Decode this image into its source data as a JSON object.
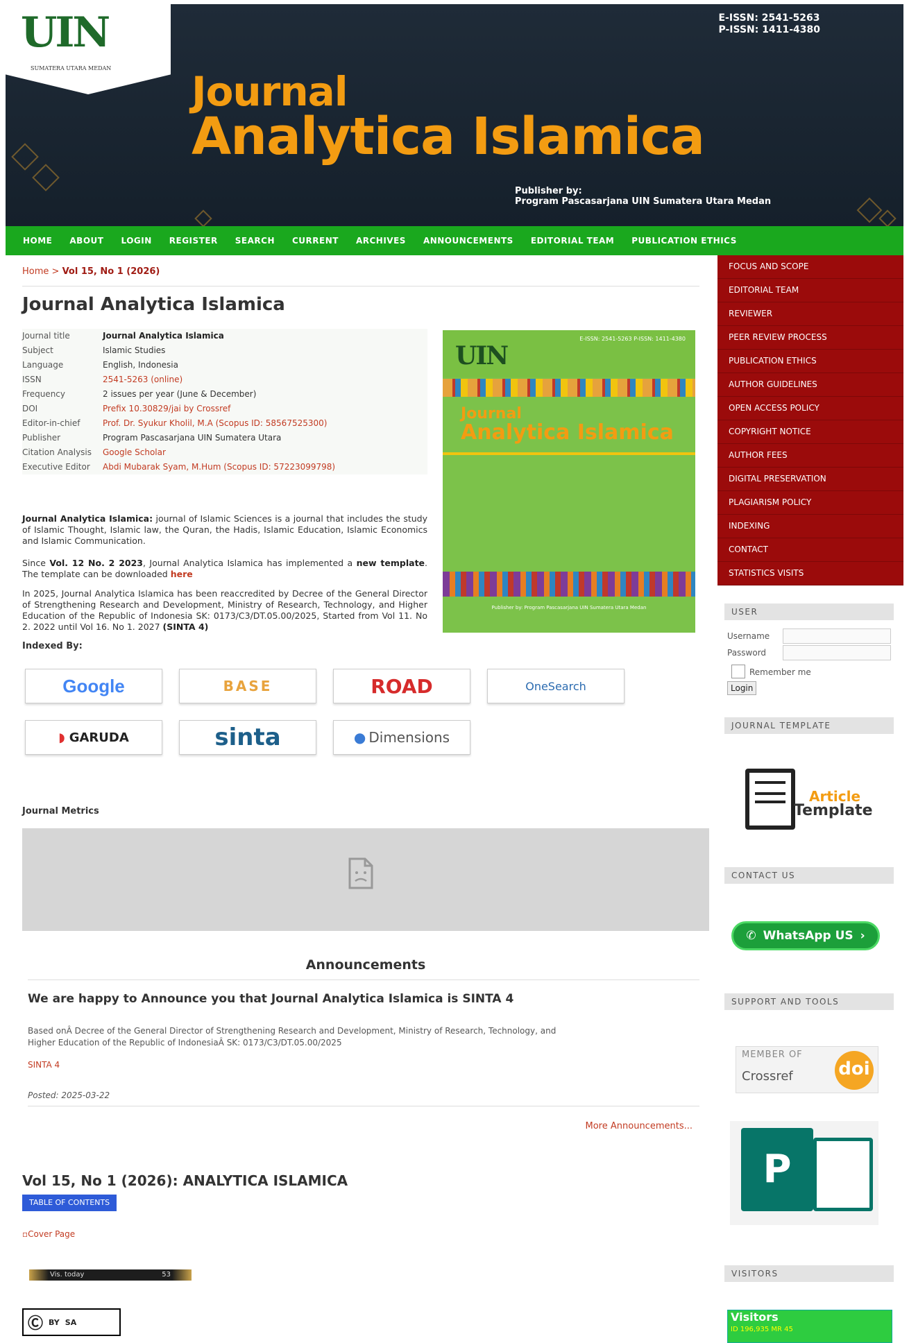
{
  "header": {
    "logo_text": "UIN",
    "logo_sub": "SUMATERA UTARA MEDAN",
    "e_issn": "E-ISSN: 2541-5263",
    "p_issn": "P-ISSN: 1411-4380",
    "journal_word": "Journal",
    "journal_name": "Analytica Islamica",
    "publisher_label": "Publisher by:",
    "publisher_name": "Program Pascasarjana UIN Sumatera Utara Medan"
  },
  "nav": [
    "HOME",
    "ABOUT",
    "LOGIN",
    "REGISTER",
    "SEARCH",
    "CURRENT",
    "ARCHIVES",
    "ANNOUNCEMENTS",
    "EDITORIAL TEAM",
    "PUBLICATION ETHICS"
  ],
  "breadcrumb": {
    "home": "Home",
    "sep": ">",
    "current": "Vol 15, No 1 (2026)"
  },
  "page_title": "Journal Analytica Islamica",
  "info": [
    {
      "label": "Journal title",
      "value": "Journal Analytica Islamica"
    },
    {
      "label": "Subject",
      "value": "Islamic Studies"
    },
    {
      "label": "Language",
      "value": "English, Indonesia"
    },
    {
      "label": "ISSN",
      "value": "2541-5263 (online)"
    },
    {
      "label": "Frequency",
      "value": "2 issues per year (June & December)"
    },
    {
      "label": "DOI",
      "value": "Prefix 10.30829/jai by Crossref"
    },
    {
      "label": "Editor-in-chief",
      "value": "Prof. Dr. Syukur Kholil, M.A (Scopus ID: 58567525300)"
    },
    {
      "label": "Publisher",
      "value": "Program Pascasarjana UIN Sumatera Utara"
    },
    {
      "label": "Citation Analysis",
      "value": "Google Scholar"
    },
    {
      "label": "Executive Editor",
      "value": "Abdi Mubarak Syam, M.Hum (Scopus ID: 57223099798)"
    }
  ],
  "cover": {
    "logo": "UIN",
    "issn": "E-ISSN: 2541-5263 P-ISSN: 1411-4380",
    "title1": "Journal",
    "title2": "Analytica Islamica",
    "pub": "Publisher by: Program Pascasarjana UIN Sumatera Utara Medan"
  },
  "about": {
    "lead": "Journal Analytica Islamica:",
    "text": " journal of Islamic Sciences is a journal that includes the study of Islamic Thought, Islamic law, the Quran, the Hadis, Islamic Education, Islamic Economics and Islamic Communication."
  },
  "template_note": {
    "pre": "Since ",
    "vol": "Vol. 12 No. 2 2023",
    "mid": ", Journal Analytica Islamica has implemented a ",
    "new_template": "new template",
    "post": ". The template can be downloaded ",
    "here": "here"
  },
  "accreditation": {
    "text": "In 2025, Journal Analytica Islamica has been reaccredited by Decree of the General Director of Strengthening Research and Development, Ministry of Research, Technology, and Higher Education of the Republic of Indonesia SK: 0173/C3/DT.05.00/2025, Started from Vol 11. No 2. 2022 until Vol 16. No 1. 2027 ",
    "grade": "(SINTA 4)"
  },
  "indexed_heading": "Indexed By:",
  "badges": [
    "Google",
    "BASE",
    "ROAD",
    "OneSearch",
    "GARUDA",
    "sinta",
    "Dimensions"
  ],
  "metrics_heading": "Journal Metrics",
  "announcements": {
    "heading": "Announcements",
    "title": "We are happy to Announce you that Journal Analytica Islamica is SINTA 4",
    "text": "Based onÂ Decree of the General Director of Strengthening Research and Development, Ministry of Research, Technology, and Higher Education of the Republic of IndonesiaÂ SK: 0173/C3/DT.05.00/2025",
    "link": "SINTA 4",
    "posted": "Posted: 2025-03-22",
    "more": "More Announcements..."
  },
  "issue": {
    "title": "Vol 15, No 1 (2026): ANALYTICA ISLAMICA",
    "toc": "TABLE OF CONTENTS",
    "cover_alt": "Cover Page",
    "counter_label": "Vis. today",
    "counter_value": "53"
  },
  "cc": {
    "by": "BY",
    "sa": "SA"
  },
  "sidebar_menu": [
    "FOCUS AND SCOPE",
    "EDITORIAL TEAM",
    "REVIEWER",
    "PEER REVIEW PROCESS",
    "PUBLICATION ETHICS",
    "AUTHOR GUIDELINES",
    "OPEN ACCESS POLICY",
    "COPYRIGHT NOTICE",
    "AUTHOR FEES",
    "DIGITAL PRESERVATION",
    "PLAGIARISM POLICY",
    "INDEXING",
    "CONTACT",
    "STATISTICS VISITS"
  ],
  "user_block": {
    "title": "USER",
    "username": "Username",
    "password": "Password",
    "remember": "Remember me",
    "login": "Login"
  },
  "template_block": {
    "title": "JOURNAL TEMPLATE",
    "line1": "Article",
    "line2": "Template"
  },
  "contact_block": {
    "title": "CONTACT US",
    "whatsapp": "WhatsApp US"
  },
  "support_block": {
    "title": "SUPPORT AND TOOLS",
    "member": "MEMBER OF",
    "crossref": "Crossref",
    "doi": "doi"
  },
  "visitors_block": {
    "title": "VISITORS",
    "label": "Visitors",
    "stats": "ID 196,935  MR 45"
  }
}
